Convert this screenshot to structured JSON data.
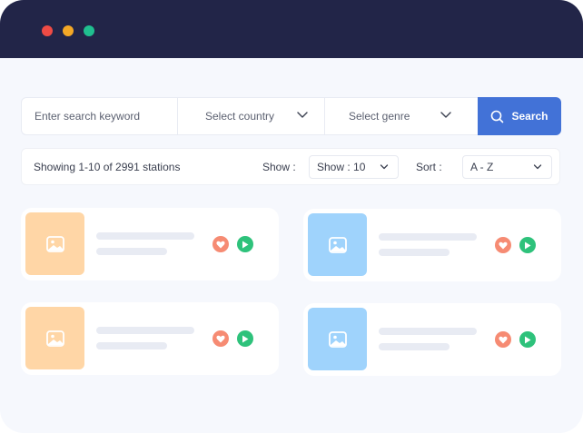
{
  "window": {
    "controls": [
      {
        "name": "close",
        "color": "#ef4b45"
      },
      {
        "name": "minimize",
        "color": "#f4a826"
      },
      {
        "name": "maximize",
        "color": "#20bf8f"
      }
    ]
  },
  "search": {
    "placeholder": "Enter search keyword",
    "country_select": "Select country",
    "genre_select": "Select genre",
    "button_label": "Search",
    "button_icon": "search-icon"
  },
  "filter": {
    "showing_text": "Showing 1-10 of 2991 stations",
    "show_label": "Show :",
    "show_value": "Show : 10",
    "sort_label": "Sort :",
    "sort_value": "A - Z"
  },
  "stations": [
    {
      "thumb_color": "orange",
      "icon": "image-icon",
      "actions": [
        "heart-icon",
        "play-icon"
      ]
    },
    {
      "thumb_color": "blue",
      "icon": "image-icon",
      "actions": [
        "heart-icon",
        "play-icon"
      ]
    },
    {
      "thumb_color": "orange",
      "icon": "image-icon",
      "actions": [
        "heart-icon",
        "play-icon"
      ]
    },
    {
      "thumb_color": "blue",
      "icon": "image-icon",
      "actions": [
        "heart-icon",
        "play-icon"
      ]
    }
  ],
  "colors": {
    "titlebar": "#222548",
    "accent": "#4272d7",
    "background": "#f6f8fd",
    "heart": "#f68b73",
    "play": "#2ec27b",
    "thumb_orange": "#ffd6a6",
    "thumb_blue": "#9fd3fc"
  }
}
